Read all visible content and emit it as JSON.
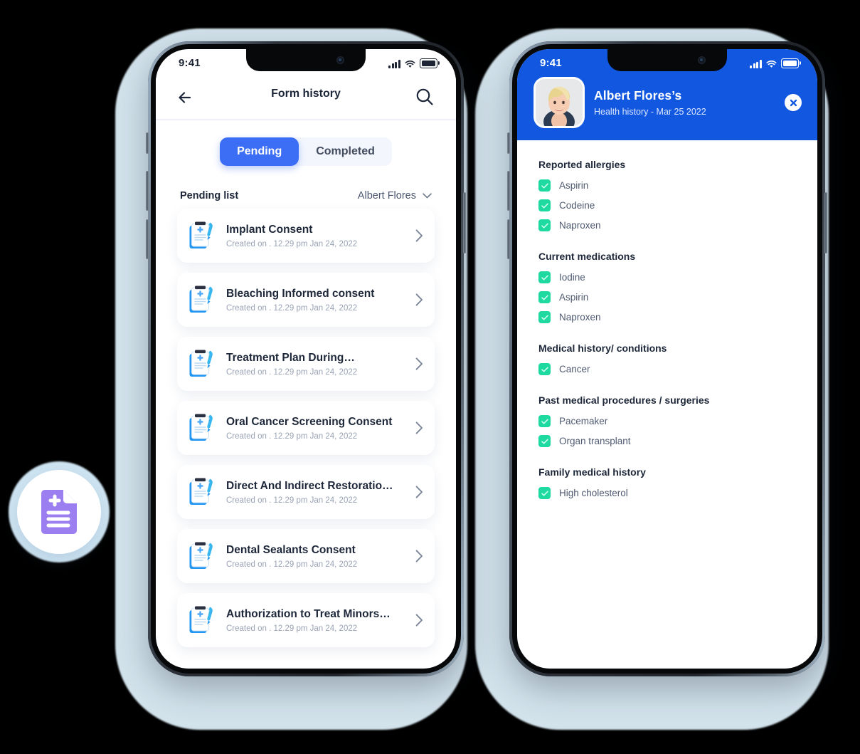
{
  "left_phone": {
    "status_bar": {
      "time": "9:41",
      "signal_icon": "cellular-signal-icon",
      "wifi_icon": "wifi-icon",
      "battery_icon": "battery-icon"
    },
    "header": {
      "back_icon": "back-arrow-icon",
      "title": "Form history",
      "search_icon": "search-icon"
    },
    "segmented": {
      "tabs": [
        {
          "label": "Pending",
          "active": true
        },
        {
          "label": "Completed",
          "active": false
        }
      ]
    },
    "list_header": {
      "label": "Pending list",
      "filter_value": "Albert Flores",
      "chevron_icon": "chevron-down-icon"
    },
    "items": [
      {
        "title": "Implant Consent",
        "subtitle": "Created on . 12.29 pm Jan 24, 2022"
      },
      {
        "title": "Bleaching Informed consent",
        "subtitle": "Created on . 12.29 pm Jan 24, 2022"
      },
      {
        "title": "Treatment Plan During…",
        "subtitle": "Created on . 12.29 pm Jan 24, 2022"
      },
      {
        "title": "Oral Cancer Screening Consent",
        "subtitle": "Created on . 12.29 pm Jan 24, 2022"
      },
      {
        "title": "Direct And Indirect Restoratio…",
        "subtitle": "Created on . 12.29 pm Jan 24, 2022"
      },
      {
        "title": "Dental Sealants Consent",
        "subtitle": "Created on . 12.29 pm Jan 24, 2022"
      },
      {
        "title": "Authorization to Treat Minors…",
        "subtitle": "Created on . 12.29 pm Jan 24, 2022"
      }
    ]
  },
  "right_phone": {
    "status_bar": {
      "time": "9:41",
      "signal_icon": "cellular-signal-icon",
      "wifi_icon": "wifi-icon",
      "battery_icon": "battery-icon"
    },
    "header": {
      "avatar_icon": "patient-avatar",
      "name": "Albert Flores’s",
      "subtitle": "Health history - Mar 25 2022",
      "close_icon": "close-icon"
    },
    "sections": [
      {
        "heading": "Reported allergies",
        "items": [
          "Aspirin",
          "Codeine",
          "Naproxen"
        ]
      },
      {
        "heading": "Current medications",
        "items": [
          "Iodine",
          "Aspirin",
          "Naproxen"
        ]
      },
      {
        "heading": "Medical history/ conditions",
        "items": [
          "Cancer"
        ]
      },
      {
        "heading": "Past medical procedures / surgeries",
        "items": [
          "Pacemaker",
          "Organ transplant"
        ]
      },
      {
        "heading": "Family medical history",
        "items": [
          "High cholesterol"
        ]
      }
    ]
  },
  "floating_badge": {
    "icon": "medical-document-icon"
  },
  "colors": {
    "accent_blue": "#3b6ef5",
    "header_blue": "#1257e0",
    "check_green": "#1ed9a0",
    "backdrop": "#d3e3ec",
    "badge_purple": "#9b7ef0",
    "text_dark": "#1d2739",
    "text_muted": "#9aa3b5"
  }
}
